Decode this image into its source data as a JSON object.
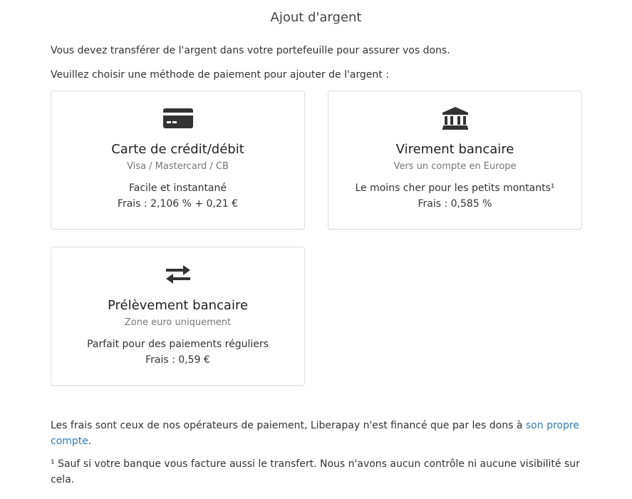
{
  "page": {
    "title": "Ajout d'argent",
    "intro_line_1": "Vous devez transférer de l'argent dans votre portefeuille pour assurer vos dons.",
    "intro_line_2": "Veuillez choisir une méthode de paiement pour ajouter de l'argent :"
  },
  "methods": [
    {
      "icon": "credit-card-icon",
      "title": "Carte de crédit/débit",
      "subtitle": "Visa / Mastercard / CB",
      "description": "Facile et instantané",
      "fee": "Frais : 2,106 % + 0,21 €"
    },
    {
      "icon": "bank-icon",
      "title": "Virement bancaire",
      "subtitle": "Vers un compte en Europe",
      "description": "Le moins cher pour les petits montants¹",
      "fee": "Frais : 0,585 %"
    },
    {
      "icon": "transfer-arrows-icon",
      "title": "Prélèvement bancaire",
      "subtitle": "Zone euro uniquement",
      "description": "Parfait pour des paiements réguliers",
      "fee": "Frais : 0,59 €"
    }
  ],
  "footer": {
    "fees_text": "Les frais sont ceux de nos opérateurs de paiement, Liberapay n'est financé que par les dons à",
    "fees_link": "son propre compte",
    "fees_end": ".",
    "note": "¹ Sauf si votre banque vous facture aussi le transfert. Nous n'avons aucun contrôle ni aucune visibilité sur cela."
  },
  "colors": {
    "icon": "#333333",
    "link": "#337ab7",
    "border": "#dddddd"
  }
}
